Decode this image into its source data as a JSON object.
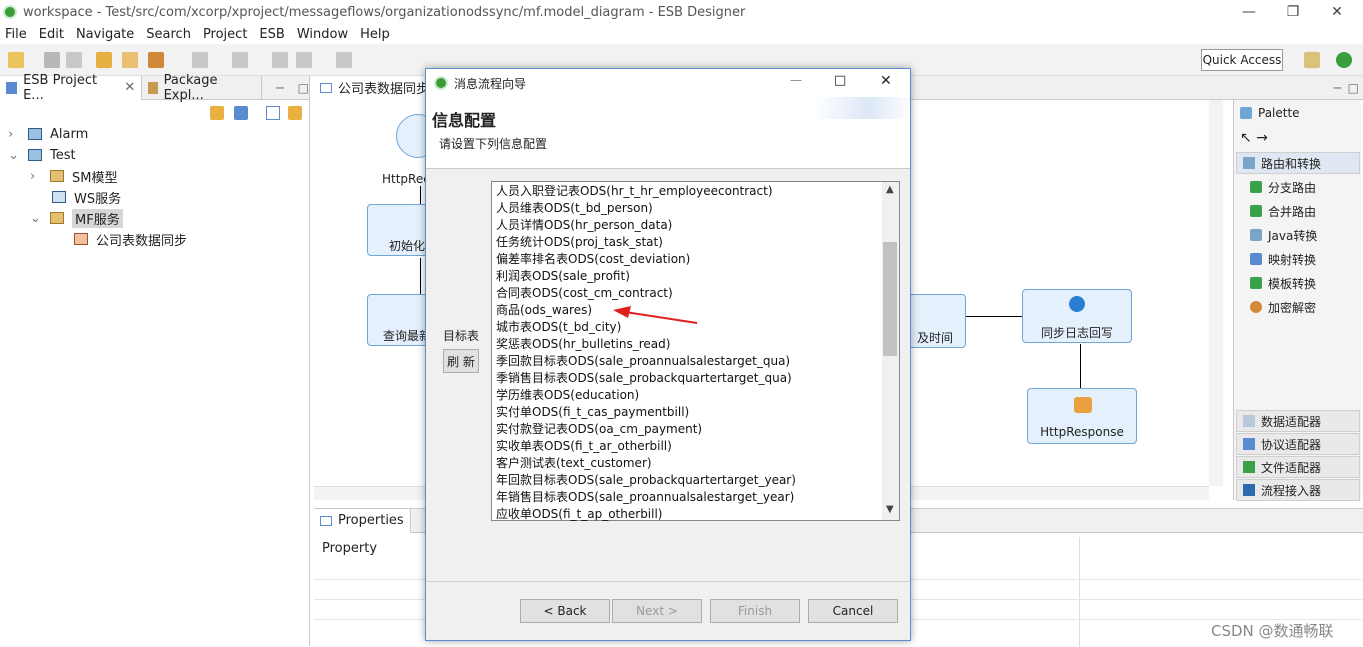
{
  "window": {
    "title": "workspace - Test/src/com/xcorp/xproject/messageflows/organizationodssync/mf.model_diagram - ESB Designer"
  },
  "menu": [
    "File",
    "Edit",
    "Navigate",
    "Search",
    "Project",
    "ESB",
    "Window",
    "Help"
  ],
  "toolbar": {
    "quick_access": "Quick Access"
  },
  "left_panel": {
    "tabs": [
      {
        "label": "ESB Project E..."
      },
      {
        "label": "Package Expl..."
      }
    ],
    "tree": [
      {
        "label": "Alarm"
      },
      {
        "label": "Test"
      },
      {
        "label": "SM模型"
      },
      {
        "label": "WS服务"
      },
      {
        "label": "MF服务"
      },
      {
        "label": "公司表数据同步"
      }
    ]
  },
  "editor": {
    "tab": "公司表数据同步",
    "nodes": {
      "http_receive": "HttpRec",
      "init": "初始化",
      "query": "查询最新",
      "time": "及时间",
      "sync_log": "同步日志回写",
      "http_response": "HttpResponse"
    }
  },
  "palette": {
    "title": "Palette",
    "routing_group": "路由和转换",
    "routing_items": [
      "分支路由",
      "合并路由",
      "Java转换",
      "映射转换",
      "模板转换",
      "加密解密"
    ],
    "groups": [
      "数据适配器",
      "协议适配器",
      "文件适配器",
      "流程接入器"
    ]
  },
  "properties": {
    "tab": "Properties",
    "column": "Property"
  },
  "dialog": {
    "title": "消息流程向导",
    "heading": "信息配置",
    "subheading": "请设置下列信息配置",
    "target_label": "目标表",
    "refresh": "刷 新",
    "items": [
      "人员入职登记表ODS(hr_t_hr_employeecontract)",
      "人员维表ODS(t_bd_person)",
      "人员详情ODS(hr_person_data)",
      "任务统计ODS(proj_task_stat)",
      "偏差率排名表ODS(cost_deviation)",
      "利润表ODS(sale_profit)",
      "合同表ODS(cost_cm_contract)",
      "商品(ods_wares)",
      "城市表ODS(t_bd_city)",
      "奖惩表ODS(hr_bulletins_read)",
      "季回款目标表ODS(sale_proannualsalestarget_qua)",
      "季销售目标表ODS(sale_probackquartertarget_qua)",
      "学历维表ODS(education)",
      "实付单ODS(fi_t_cas_paymentbill)",
      "实付款登记表ODS(oa_cm_payment)",
      "实收单表ODS(fi_t_ar_otherbill)",
      "客户测试表(text_customer)",
      "年回款目标表ODS(sale_probackquartertarget_year)",
      "年销售目标表ODS(sale_proannualsalestarget_year)",
      "应收单ODS(fi_t_ap_otherbill)"
    ],
    "buttons": {
      "back": "< Back",
      "next": "Next >",
      "finish": "Finish",
      "cancel": "Cancel"
    }
  },
  "watermark": "CSDN @数通畅联"
}
